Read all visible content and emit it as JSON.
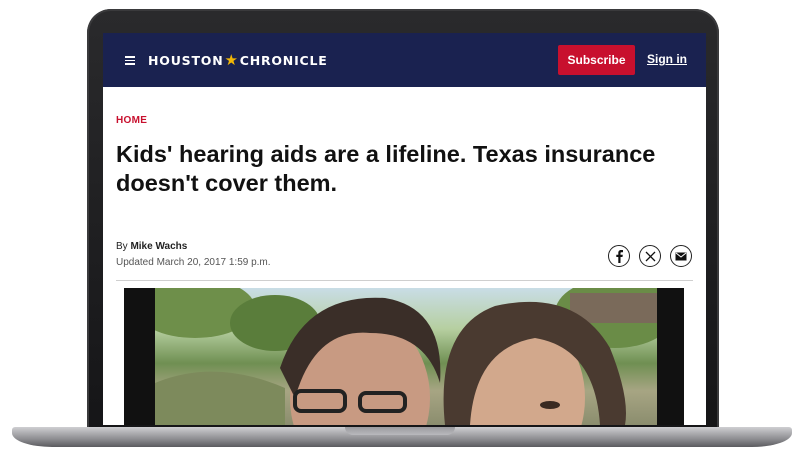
{
  "header": {
    "logo_left": "HOUSTON",
    "logo_star": "★",
    "logo_right": "CHRONICLE",
    "subscribe_label": "Subscribe",
    "signin_label": "Sign in",
    "bg_color": "#1a2250",
    "accent_color": "#c8102e"
  },
  "article": {
    "section": "HOME",
    "headline": "Kids' hearing aids are a lifeline. Texas insurance doesn't cover them.",
    "byline_prefix": "By",
    "author": "Mike Wachs",
    "updated": "Updated March 20, 2017 1:59 p.m.",
    "share_icons": [
      "facebook-icon",
      "x-icon",
      "email-icon"
    ]
  }
}
